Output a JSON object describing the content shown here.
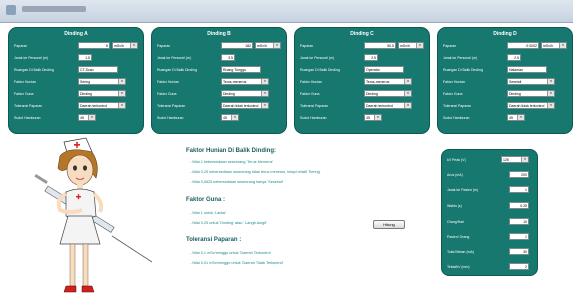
{
  "window": {
    "title": ""
  },
  "panels": [
    {
      "title": "Dinding A",
      "paparan": {
        "label": "Paparan",
        "value": "8",
        "unit": "mSv/h"
      },
      "jarak": {
        "label": "Jarak ke Personel (m)",
        "value": "1.5"
      },
      "ruangan": {
        "label": "Ruangan Di Balik Dinding",
        "value": "CT-Scan"
      },
      "hunian": {
        "label": "Faktor Hunian",
        "value": "Sering"
      },
      "guna": {
        "label": "Faktor Guna",
        "value": "Dinding"
      },
      "toleransi": {
        "label": "Toleransi Paparan",
        "value": "Daerah terkontrol"
      },
      "sudut": {
        "label": "Sudut Hamburan",
        "value": "45"
      }
    },
    {
      "title": "Dinding B",
      "paparan": {
        "label": "Paparan",
        "value": "182",
        "unit": "mSv/h"
      },
      "jarak": {
        "label": "Jarak ke Personel (m)",
        "value": "3.5"
      },
      "ruangan": {
        "label": "Ruangan Di Balik Dinding",
        "value": "Ruang Tunggu"
      },
      "hunian": {
        "label": "Faktor Hunian",
        "value": "Terus-menerus"
      },
      "guna": {
        "label": "Faktor Guna",
        "value": "Dinding"
      },
      "toleransi": {
        "label": "Toleransi Paparan",
        "value": "Daerah tidak terkontrol"
      },
      "sudut": {
        "label": "Sudut Hamburan",
        "value": "45"
      }
    },
    {
      "title": "Dinding C",
      "paparan": {
        "label": "Paparan",
        "value": "50.5",
        "unit": "mSv/h"
      },
      "jarak": {
        "label": "Jarak ke Personel (m)",
        "value": "2.5"
      },
      "ruangan": {
        "label": "Ruangan Di Balik Dinding",
        "value": "Operator"
      },
      "hunian": {
        "label": "Faktor Hunian",
        "value": "Terus-menerus"
      },
      "guna": {
        "label": "Faktor Guna",
        "value": "Dinding"
      },
      "toleransi": {
        "label": "Toleransi Paparan",
        "value": "Daerah terkontrol"
      },
      "sudut": {
        "label": "Sudut Hamburan",
        "value": "45"
      }
    },
    {
      "title": "Dinding D",
      "paparan": {
        "label": "Paparan",
        "value": "0.0002",
        "unit": "mSv/h"
      },
      "jarak": {
        "label": "Jarak ke Personel (m)",
        "value": "2.5"
      },
      "ruangan": {
        "label": "Ruangan Di Balik Dinding",
        "value": "Halaman"
      },
      "hunian": {
        "label": "Faktor Hunian",
        "value": "Seselali"
      },
      "guna": {
        "label": "Faktor Guna",
        "value": "Dinding"
      },
      "toleransi": {
        "label": "Toleransi Paparan",
        "value": "Daerah tidak terkontrol"
      },
      "sudut": {
        "label": "Sudut Hamburan",
        "value": "45"
      }
    }
  ],
  "info": {
    "hunian_title": "Faktor Hunian Di Balik Dinding:",
    "hunian_lines": [
      "- Nilai 1 kebersediaan seseorang 'Terus Menerus'",
      "- Nilai 0,25 kebersediaan seseorang tidak terus menerus, tetapi relatif 'Sering'",
      "- Nilai 0,0625 kebersediaan seseorang hanya 'Sesekali'"
    ],
    "guna_title": "Faktor Guna :",
    "guna_lines": [
      "- Nilai 1 untuk 'Lantai'",
      "- Nilai 0,25 untuk 'Dinding' atau ' Langit-langit'"
    ],
    "toleransi_title": "Toleransi Paparan :",
    "toleransi_lines": [
      "- Nilai 0,1 mSv/minggu untuk 'Daerah Terkontrol'",
      "- Nilai 0,01 mSv/minggu untuk 'Daerah Tidak Terkontrol'"
    ]
  },
  "hitung_label": "Hitung",
  "right_panel": [
    {
      "label": "kV Peak (V)",
      "value": "125",
      "type": "select"
    },
    {
      "label": "Arus (mA)",
      "value": "200",
      "type": "input"
    },
    {
      "label": "Jarak ke Pasien (m)",
      "value": "1",
      "type": "input"
    },
    {
      "label": "Waktu (s)",
      "value": "0.25",
      "type": "input"
    },
    {
      "label": "Orang/Hari",
      "value": "10",
      "type": "input"
    },
    {
      "label": "Pasien/ Orang",
      "value": "1",
      "type": "input"
    },
    {
      "label": "Total Beban (mA)",
      "value": "30",
      "type": "input"
    },
    {
      "label": "Tebal/kV (mm)",
      "value": "2",
      "type": "input"
    }
  ],
  "colors": {
    "panel": "#16786e",
    "heading": "#1a5e60",
    "info_text": "#1f8a8a"
  }
}
